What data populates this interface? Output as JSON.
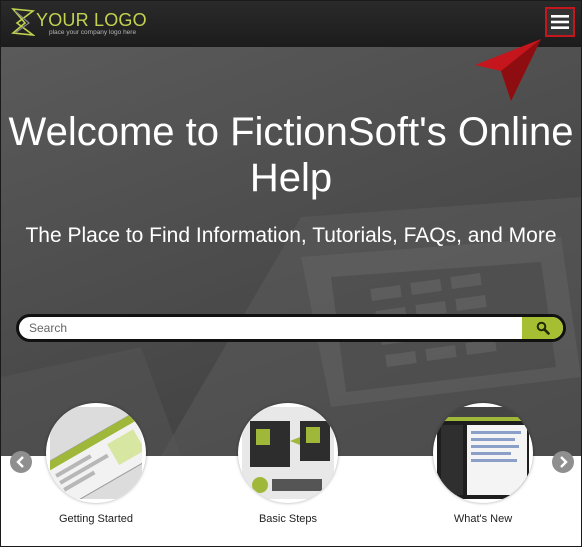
{
  "header": {
    "logo_name": "YOUR LOGO",
    "logo_tagline": "place your company logo here",
    "menu_icon": "hamburger-icon",
    "accent_color": "#c2d24f",
    "callout_color": "#c4161c"
  },
  "hero": {
    "title": "Welcome to FictionSoft's Online Help",
    "subtitle": "The Place to Find Information, Tutorials, FAQs, and More"
  },
  "search": {
    "placeholder": "Search",
    "value": "",
    "button_icon": "search-icon",
    "button_color": "#a6bf32"
  },
  "tiles": [
    {
      "label": "Getting Started"
    },
    {
      "label": "Basic Steps"
    },
    {
      "label": "What's New"
    }
  ],
  "carousel": {
    "prev_icon": "chevron-left-icon",
    "next_icon": "chevron-right-icon"
  }
}
